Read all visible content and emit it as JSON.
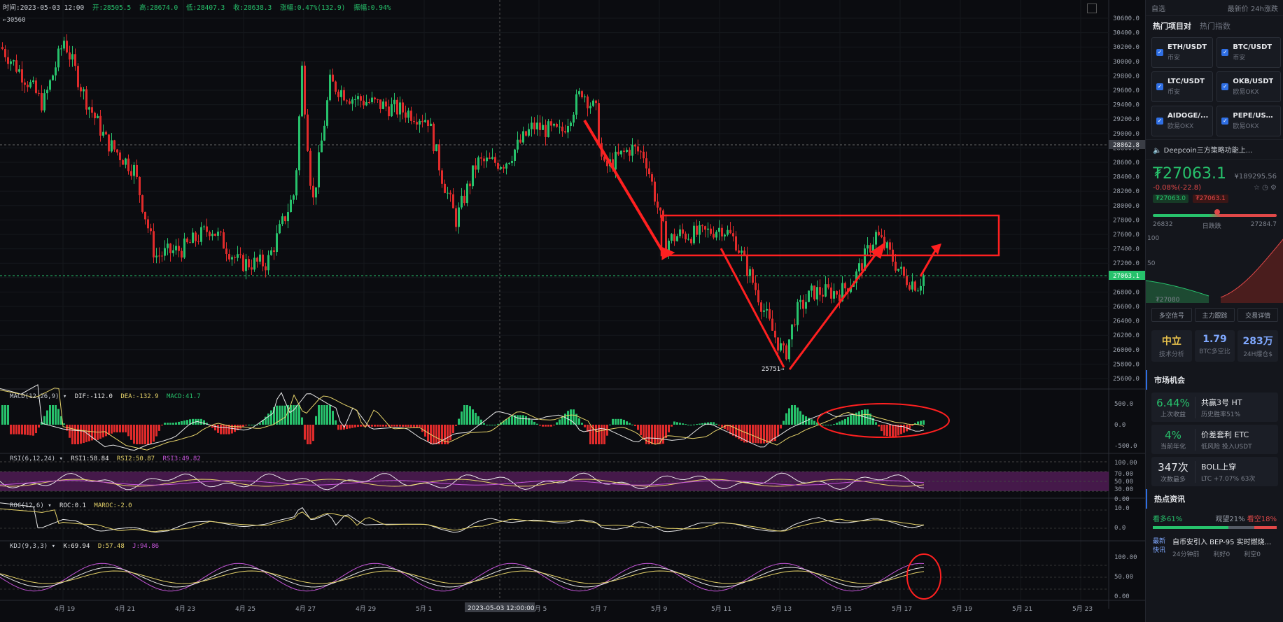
{
  "info_bar": {
    "time": "时间:2023-05-03 12:00",
    "open": "开:28505.5",
    "high": "高:28674.0",
    "low": "低:28407.3",
    "close": "收:28638.3",
    "change": "涨幅:0.47%(132.9)",
    "amplitude": "振幅:0.94%"
  },
  "top_marker": "30560",
  "low_marker": "25751",
  "price_axis": [
    "30600.0",
    "30400.0",
    "30200.0",
    "30000.0",
    "29800.0",
    "29600.0",
    "29400.0",
    "29200.0",
    "29000.0",
    "28800.0",
    "28600.0",
    "28400.0",
    "28200.0",
    "28000.0",
    "27800.0",
    "27600.0",
    "27400.0",
    "27200.0",
    "27000.0",
    "26800.0",
    "26600.0",
    "26400.0",
    "26200.0",
    "26000.0",
    "25800.0",
    "25600.0"
  ],
  "crosshair_price": "28862.8",
  "current_price_tag": "27063.1",
  "date_axis": [
    "4月 19",
    "4月 21",
    "4月 23",
    "4月 25",
    "4月 27",
    "4月 29",
    "5月 1",
    "5月 5",
    "5月 7",
    "5月 9",
    "5月 11",
    "5月 13",
    "5月 15",
    "5月 17",
    "5月 19",
    "5月 21",
    "5月 23"
  ],
  "crosshair_date": "2023-05-03 12:00:00",
  "indicators": {
    "macd": {
      "name": "MACD(12,26,9)",
      "dif": "DIF:-112.0",
      "dea": "DEA:-132.9",
      "macd": "MACD:41.7",
      "axis": [
        "500.0",
        "0.0",
        "-500.0"
      ]
    },
    "rsi": {
      "name": "RSI(6,12,24)",
      "r1": "RSI1:58.84",
      "r2": "RSI2:50.87",
      "r3": "RSI3:49.82",
      "axis": [
        "100.00",
        "70.00",
        "50.00",
        "30.00",
        "0.00"
      ]
    },
    "roc": {
      "name": "ROC(12,6)",
      "roc": "ROC:0.1",
      "maroc": "MAROC:-2.0",
      "axis": [
        "10.0",
        "0.0"
      ]
    },
    "kdj": {
      "name": "KDJ(9,3,3)",
      "k": "K:69.94",
      "d": "D:57.48",
      "j": "J:94.86",
      "axis": [
        "100.00",
        "50.00",
        "0.00"
      ]
    }
  },
  "colors": {
    "up": "#27c26c",
    "down": "#e02b2b",
    "annot": "#ff2020",
    "dif": "#e8e8e8",
    "dea": "#e6d36a",
    "rsi_band": "#5a1d5e",
    "kdj_j": "#c455d8"
  },
  "side": {
    "top_left": "自选",
    "top_right": "最新价  24h涨跌",
    "tab_hot": "热门项目对",
    "tab_index": "热门指数",
    "pairs": [
      {
        "name": "ETH/USDT",
        "ex": "币安"
      },
      {
        "name": "BTC/USDT",
        "ex": "币安"
      },
      {
        "name": "LTC/USDT",
        "ex": "币安"
      },
      {
        "name": "OKB/USDT",
        "ex": "欧易OKX"
      },
      {
        "name": "AIDOGE/...",
        "ex": "欧易OKX"
      },
      {
        "name": "PEPE/USDT",
        "ex": "欧易OKX"
      }
    ],
    "news_ticker": "Deepcoin三方策略功能上...",
    "price": "27063.1",
    "price_cny": "¥189295.56",
    "change": "-0.08%(-22.8)",
    "badge_bid": "₮27063.0",
    "badge_ask": "₮27063.1",
    "range_low": "26832",
    "range_label": "日跌跌",
    "range_high": "27284.7",
    "depth_axis": [
      "100",
      "50"
    ],
    "depth_price": "₮27080",
    "mini_buttons": [
      "多空信号",
      "主力跟踪",
      "交易详情"
    ],
    "stats": [
      {
        "value": "中立",
        "label": "技术分析",
        "color": "#e6c04a"
      },
      {
        "value": "1.79",
        "label": "BTC多空比",
        "color": "#7fa8ff"
      },
      {
        "value": "283万",
        "label": "24H爆仓$",
        "color": "#7fa8ff"
      }
    ],
    "market_title": "市场机会",
    "opportunities": [
      {
        "v": "6.44%",
        "s": "上次收益",
        "t": "共赢3号 HT",
        "d": "历史胜率51%",
        "c": "#27c26c"
      },
      {
        "v": "4%",
        "s": "当前年化",
        "t": "价差套利 ETC",
        "d": "低风险  投入USDT",
        "c": "#27c26c"
      },
      {
        "v": "347次",
        "s": "次数最多",
        "t": "BOLL上穿",
        "d": "LTC +7.07% 63次",
        "c": "#e6e8ec"
      }
    ],
    "hot_title": "热点资讯",
    "sent_long": "看多61%",
    "sent_mid": "观望21%",
    "sent_short": "看空18%",
    "news_tag": "最新快讯",
    "news_text": "自币安引入 BEP-95 实时燃烧...",
    "news_time": "24分钟前",
    "news_good": "利好0",
    "news_bad": "利空0"
  }
}
